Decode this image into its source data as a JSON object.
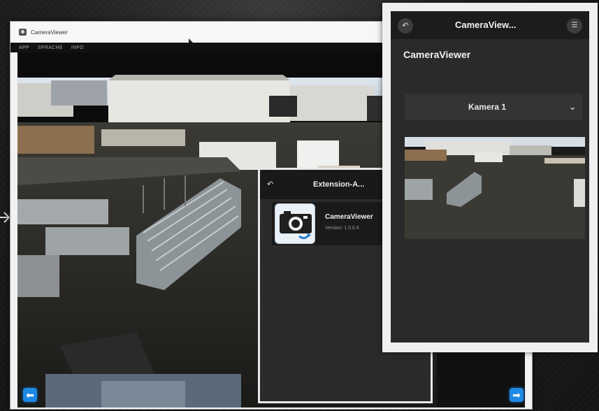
{
  "desktop_window": {
    "title": "CameraViewer",
    "menu": [
      "APP",
      "SPRACHE",
      "INFO"
    ],
    "nav_prev_icon": "arrow-left-icon",
    "nav_next_icon": "arrow-right-icon",
    "accent_color": "#1e88e5"
  },
  "extension_panel": {
    "header_title": "Extension-A...",
    "back_icon": "back-icon",
    "item": {
      "name": "CameraViewer",
      "version": "Version: 1.0.0.4",
      "icon": "camera-icon"
    }
  },
  "phone_panel": {
    "header_title": "CameraView...",
    "back_icon": "back-icon",
    "menu_icon": "menu-list-icon",
    "app_title": "CameraViewer",
    "camera_select": {
      "selected": "Kamera 1",
      "icon": "chevron-down-icon"
    }
  }
}
